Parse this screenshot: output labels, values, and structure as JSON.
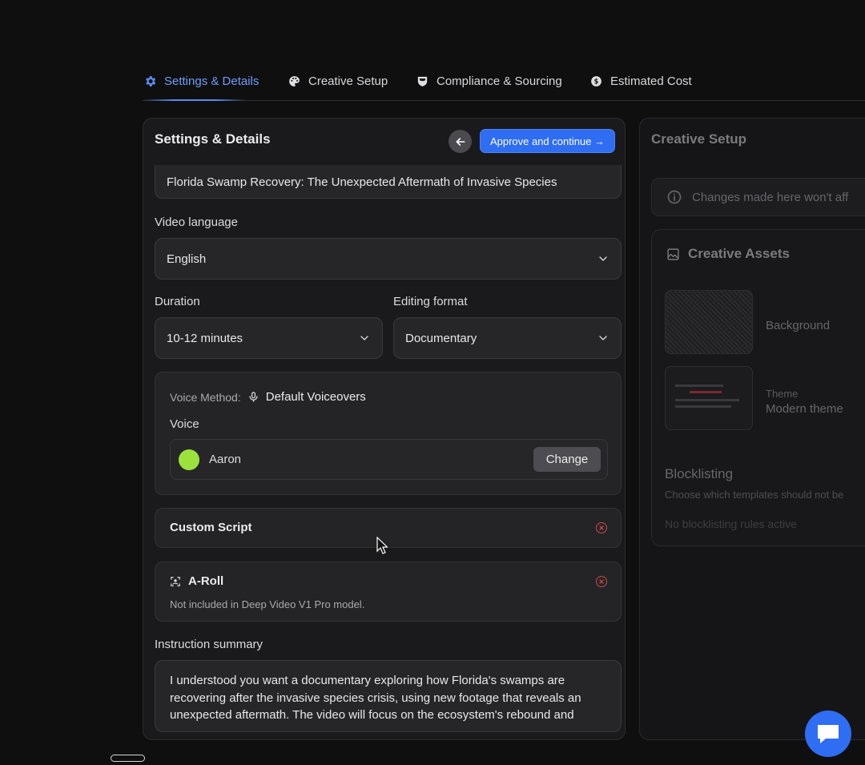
{
  "tabs": [
    {
      "label": "Settings & Details",
      "icon": "gear-icon",
      "active": true
    },
    {
      "label": "Creative Setup",
      "icon": "palette-icon",
      "active": false
    },
    {
      "label": "Compliance & Sourcing",
      "icon": "shield-icon",
      "active": false
    },
    {
      "label": "Estimated Cost",
      "icon": "dollar-icon",
      "active": false
    }
  ],
  "settings": {
    "title": "Settings & Details",
    "approve_label": "Approve and continue →",
    "video_title_value": "Florida Swamp Recovery: The Unexpected Aftermath of Invasive Species",
    "language_label": "Video language",
    "language_value": "English",
    "duration_label": "Duration",
    "duration_value": "10-12 minutes",
    "format_label": "Editing format",
    "format_value": "Documentary",
    "voice_method_label": "Voice Method:",
    "voice_method_value": "Default Voiceovers",
    "voice_label": "Voice",
    "voice_name": "Aaron",
    "voice_color": "#9be33c",
    "change_label": "Change",
    "custom_script_label": "Custom Script",
    "aroll_label": "A-Roll",
    "aroll_note": "Not included in Deep Video V1 Pro model.",
    "instruction_label": "Instruction summary",
    "instruction_text": "I understood you want a documentary exploring how Florida's swamps are recovering after the invasive species crisis, using new footage that reveals an unexpected aftermath. The video will focus on the ecosystem's rebound and"
  },
  "creative": {
    "title": "Creative Setup",
    "info_text": "Changes made here won't aff",
    "assets_title": "Creative Assets",
    "background_label": "Background",
    "theme_label": "Theme",
    "theme_value": "Modern theme",
    "blocklisting_title": "Blocklisting",
    "blocklisting_desc": "Choose which templates should not be",
    "blocklisting_status": "No blocklisting rules active"
  },
  "colors": {
    "accent": "#2f6df2",
    "active_tab": "#6f9df7",
    "remove_icon": "#c84a4a"
  }
}
